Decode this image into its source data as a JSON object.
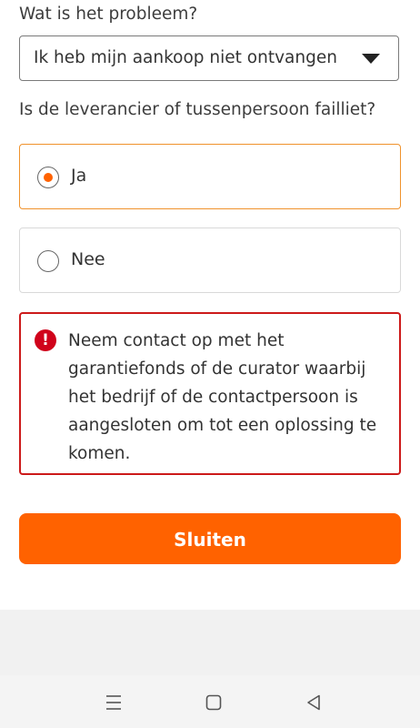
{
  "question_problem": {
    "label": "Wat is het probleem?",
    "selected_value": "Ik heb mijn aankoop niet ontvangen"
  },
  "question_bankrupt": {
    "label": "Is de leverancier of tussenpersoon failliet?",
    "options": [
      {
        "label": "Ja",
        "selected": true
      },
      {
        "label": "Nee",
        "selected": false
      }
    ]
  },
  "alert": {
    "icon": "exclamation-circle-icon",
    "icon_glyph": "!",
    "message": "Neem contact op met het garantiefonds of de curator waarbij het bedrijf of de contactpersoon is aangesloten om tot een oplossing te komen.",
    "color": "#cc1a1a"
  },
  "close_button": {
    "label": "Sluiten",
    "color": "#ff6200"
  },
  "system_nav": {
    "items": [
      "menu-lines-icon",
      "home-square-icon",
      "back-triangle-icon"
    ]
  },
  "colors": {
    "accent": "#ff6200",
    "selected_border": "#f0922c",
    "error": "#cc1a1a"
  }
}
